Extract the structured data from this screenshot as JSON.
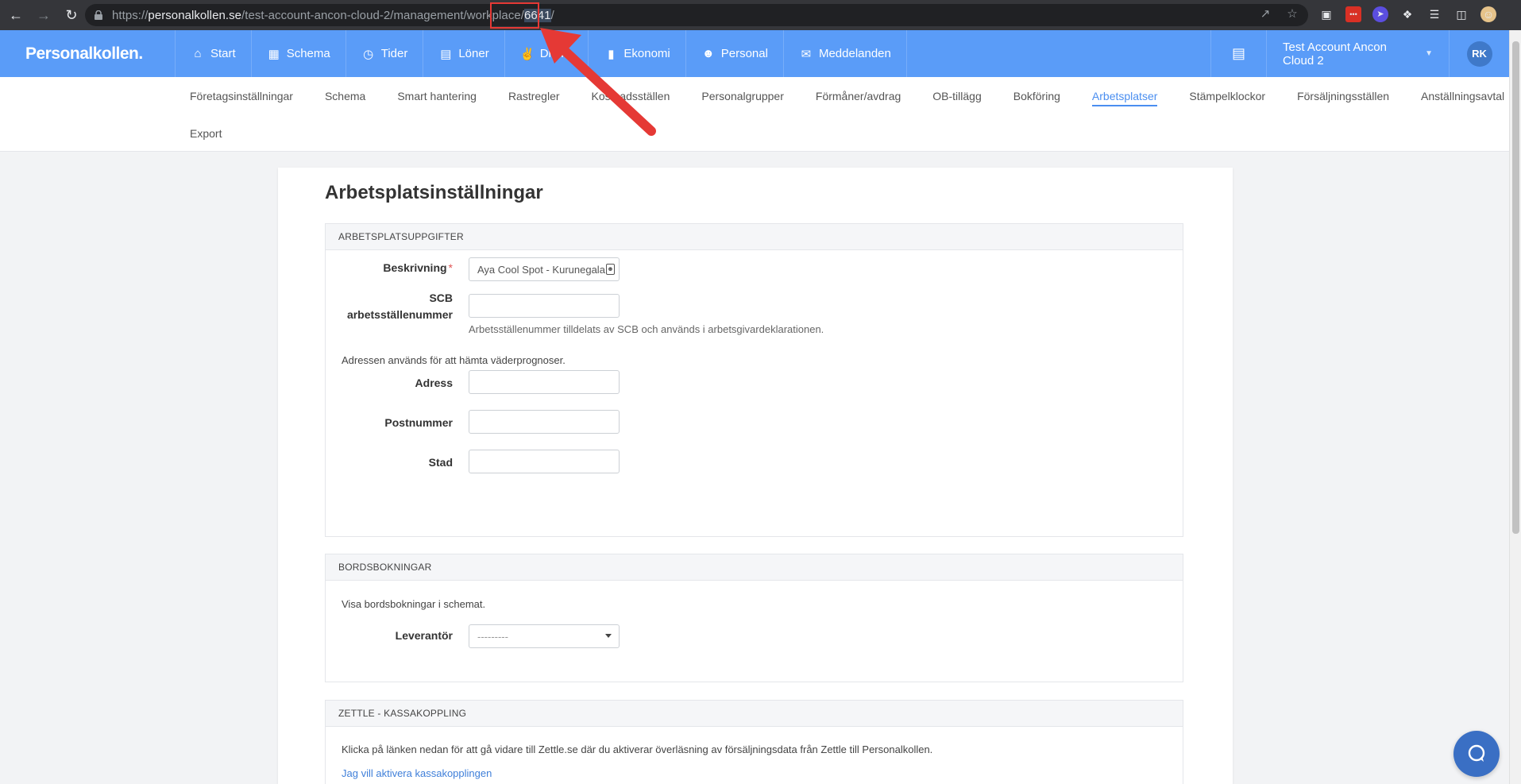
{
  "browser": {
    "url_prefix": "https://",
    "url_host": "personalkollen.se",
    "url_path": "/test-account-ancon-cloud-2/management/workplace/",
    "url_selected": "6641",
    "url_suffix": "/"
  },
  "app": {
    "logo": "Personalkollen."
  },
  "main_nav": [
    {
      "label": "Start",
      "icon": "home-icon"
    },
    {
      "label": "Schema",
      "icon": "calendar-icon"
    },
    {
      "label": "Tider",
      "icon": "clock-icon"
    },
    {
      "label": "Löner",
      "icon": "document-icon"
    },
    {
      "label": "Dricks",
      "icon": "hand-icon"
    },
    {
      "label": "Ekonomi",
      "icon": "bar-chart-icon"
    },
    {
      "label": "Personal",
      "icon": "person-icon"
    },
    {
      "label": "Meddelanden",
      "icon": "mail-icon"
    }
  ],
  "account": {
    "name": "Test Account Ancon Cloud 2",
    "initials": "RK"
  },
  "sub_nav": {
    "row1": [
      "Företagsinställningar",
      "Schema",
      "Smart hantering",
      "Rastregler",
      "Kostnadsställen",
      "Personalgrupper",
      "Förmåner/avdrag",
      "OB-tillägg",
      "Bokföring",
      "Arbetsplatser",
      "Stämpelklockor",
      "Försäljningsställen",
      "Anställningsavtal"
    ],
    "row2": [
      "Export"
    ],
    "active": "Arbetsplatser"
  },
  "page": {
    "title": "Arbetsplatsinställningar"
  },
  "panel_workplace": {
    "heading": "ARBETSPLATSUPPGIFTER",
    "description_label": "Beskrivning",
    "description_value": "Aya Cool Spot - Kurunegala",
    "scb_label_1": "SCB",
    "scb_label_2": "arbetsställenummer",
    "scb_value": "",
    "scb_help": "Arbetsställenummer tilldelats av SCB och används i arbetsgivardeklarationen.",
    "address_note": "Adressen används för att hämta väderprognoser.",
    "address_label": "Adress",
    "address_value": "",
    "postal_label": "Postnummer",
    "postal_value": "",
    "city_label": "Stad",
    "city_value": ""
  },
  "panel_booking": {
    "heading": "BORDSBOKNINGAR",
    "note": "Visa bordsbokningar i schemat.",
    "provider_label": "Leverantör",
    "provider_value": "---------"
  },
  "panel_zettle": {
    "heading": "ZETTLE - KASSAKOPPLING",
    "note": "Klicka på länken nedan för att gå vidare till Zettle.se där du aktiverar överläsning av försäljningsdata från Zettle till Personalkollen.",
    "link": "Jag vill aktivera kassakopplingen"
  },
  "colors": {
    "header_blue": "#5a9cf8",
    "active_link": "#4a8ef0",
    "annotation_red": "#e53935"
  }
}
